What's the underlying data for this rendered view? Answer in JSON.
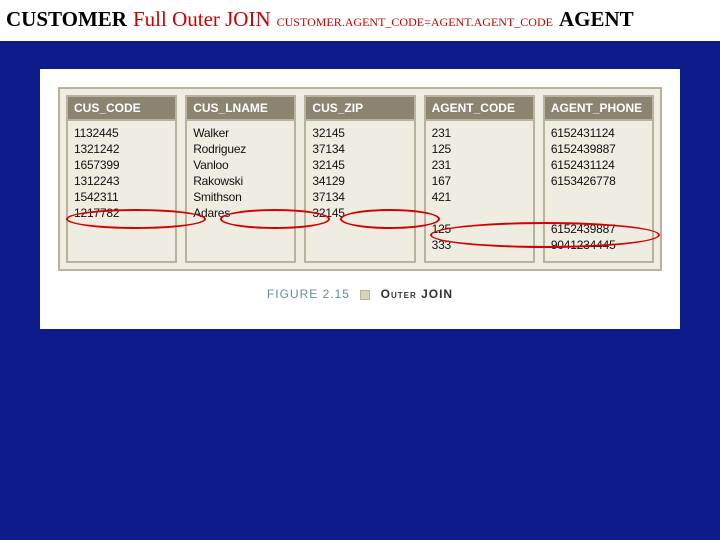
{
  "title": {
    "left": "CUSTOMER",
    "mid": "Full Outer JOIN",
    "condition": "CUSTOMER.AGENT_CODE=AGENT.AGENT_CODE",
    "right": "AGENT"
  },
  "columns": [
    {
      "header": "CUS_CODE",
      "rows": [
        "1132445",
        "1321242",
        "1657399",
        "1312243",
        "1542311",
        "1217782",
        "",
        ""
      ]
    },
    {
      "header": "CUS_LNAME",
      "rows": [
        "Walker",
        "Rodriguez",
        "Vanloo",
        "Rakowski",
        "Smithson",
        "Adares",
        "",
        ""
      ]
    },
    {
      "header": "CUS_ZIP",
      "rows": [
        "32145",
        "37134",
        "32145",
        "34129",
        "37134",
        "32145",
        "",
        ""
      ]
    },
    {
      "header": "AGENT_CODE",
      "rows": [
        "231",
        "125",
        "231",
        "167",
        "421",
        "",
        "125",
        "333"
      ]
    },
    {
      "header": "AGENT_PHONE",
      "rows": [
        "6152431124",
        "6152439887",
        "6152431124",
        "6153426778",
        "",
        "",
        "6152439887",
        "9041234445"
      ]
    }
  ],
  "figure": {
    "label": "FIGURE 2.15",
    "title": "Outer JOIN"
  },
  "chart_data": {
    "type": "table",
    "title": "CUSTOMER Full Outer JOIN AGENT on CUSTOMER.AGENT_CODE = AGENT.AGENT_CODE",
    "columns": [
      "CUS_CODE",
      "CUS_LNAME",
      "CUS_ZIP",
      "AGENT_CODE",
      "AGENT_PHONE"
    ],
    "rows": [
      [
        "1132445",
        "Walker",
        "32145",
        "231",
        "6152431124"
      ],
      [
        "1321242",
        "Rodriguez",
        "37134",
        "125",
        "6152439887"
      ],
      [
        "1657399",
        "Vanloo",
        "32145",
        "231",
        "6152431124"
      ],
      [
        "1312243",
        "Rakowski",
        "34129",
        "167",
        "6153426778"
      ],
      [
        "1542311",
        "Smithson",
        "37134",
        "421",
        ""
      ],
      [
        "1217782",
        "Adares",
        "32145",
        "",
        ""
      ],
      [
        "",
        "",
        "",
        "125",
        "6152439887"
      ],
      [
        "",
        "",
        "",
        "333",
        "9041234445"
      ]
    ]
  }
}
